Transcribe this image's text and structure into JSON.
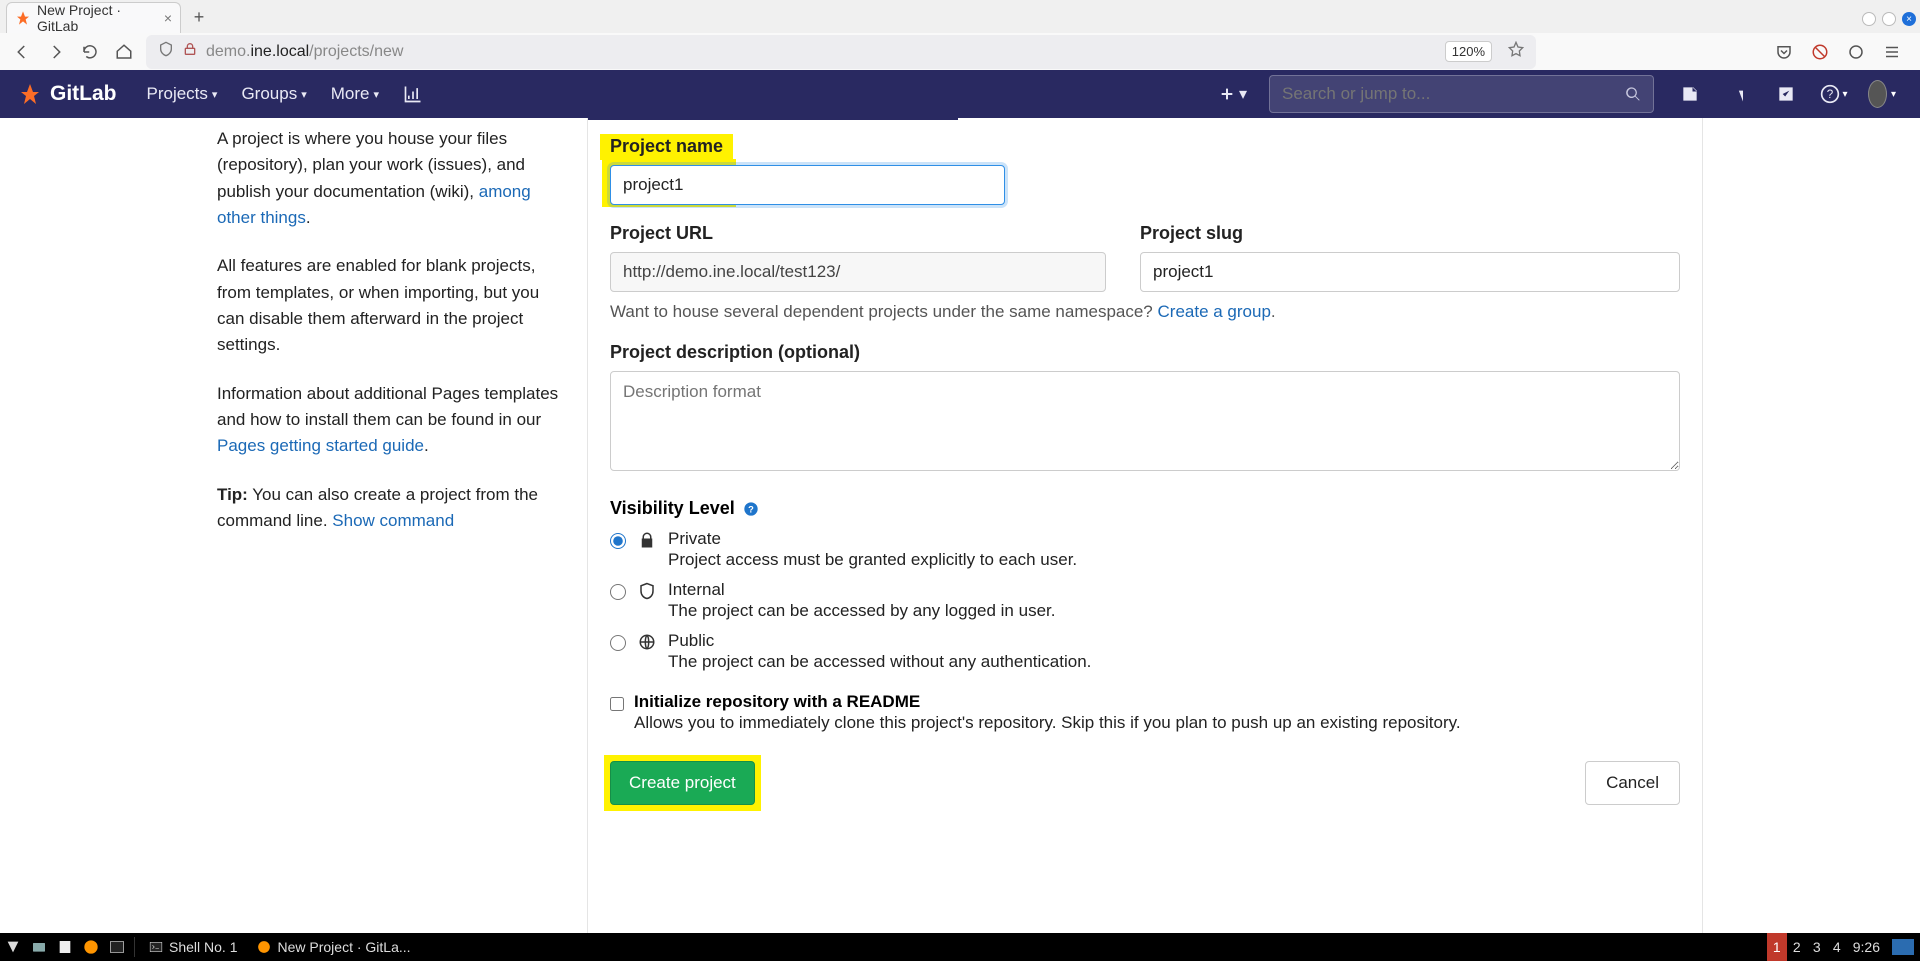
{
  "browser": {
    "tab_title": "New Project · GitLab",
    "url_prefix": "demo.",
    "url_host": "ine.local",
    "url_path": "/projects/new",
    "zoom": "120%"
  },
  "gitlab_nav": {
    "brand": "GitLab",
    "projects": "Projects",
    "groups": "Groups",
    "more": "More",
    "search_placeholder": "Search or jump to..."
  },
  "left": {
    "p1_a": "A project is where you house your files (repository), plan your work (issues), and publish your documentation (wiki), ",
    "p1_link": "among other things",
    "p1_b": ".",
    "p2": "All features are enabled for blank projects, from templates, or when importing, but you can disable them afterward in the project settings.",
    "p3_a": "Information about additional Pages templates and how to install them can be found in our ",
    "p3_link": "Pages getting started guide",
    "p3_b": ".",
    "tip_label": "Tip:",
    "tip_text": " You can also create a project from the command line. ",
    "tip_link": "Show command"
  },
  "form": {
    "name_label": "Project name",
    "name_value": "project1",
    "url_label": "Project URL",
    "url_value": "http://demo.ine.local/test123/",
    "slug_label": "Project slug",
    "slug_value": "project1",
    "group_help_a": "Want to house several dependent projects under the same namespace? ",
    "group_help_link": "Create a group",
    "group_help_b": ".",
    "desc_label": "Project description (optional)",
    "desc_placeholder": "Description format",
    "vis_label": "Visibility Level",
    "vis": {
      "private_name": "Private",
      "private_desc": "Project access must be granted explicitly to each user.",
      "internal_name": "Internal",
      "internal_desc": "The project can be accessed by any logged in user.",
      "public_name": "Public",
      "public_desc": "The project can be accessed without any authentication."
    },
    "readme_title": "Initialize repository with a README",
    "readme_desc": "Allows you to immediately clone this project's repository. Skip this if you plan to push up an existing repository.",
    "create_btn": "Create project",
    "cancel_btn": "Cancel"
  },
  "taskbar": {
    "shell": "Shell No. 1",
    "firefox_task": "New Project · GitLa...",
    "workspaces": [
      "1",
      "2",
      "3",
      "4"
    ],
    "clock": "9:26"
  }
}
